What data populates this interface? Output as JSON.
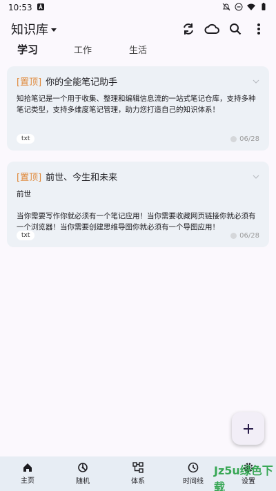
{
  "status_bar": {
    "time": "10:53"
  },
  "app_bar": {
    "library_title": "知识库",
    "actions": [
      "sync-icon",
      "cloud-icon",
      "search-icon",
      "more-icon"
    ]
  },
  "tabs": [
    {
      "label": "学习",
      "active": true
    },
    {
      "label": "工作",
      "active": false
    },
    {
      "label": "生活",
      "active": false
    }
  ],
  "notes": [
    {
      "pin_label": "[置顶]",
      "title": "你的全能笔记助手",
      "body": "知拾笔记是一个用于收集、整理和编辑信息流的一站式笔记仓库，支持多种笔记类型，支持多维度笔记管理，助力您打造自己的知识体系！",
      "tag": "txt",
      "date": "06/28"
    },
    {
      "pin_label": "[置顶]",
      "title": "前世、今生和未来",
      "body": "前世\n\n当你需要写作你就必须有一个笔记应用！当你需要收藏网页链接你就必须有一个浏览器！当你需要创建思维导图你就必须有一个导图应用！",
      "tag": "txt",
      "date": "06/28"
    }
  ],
  "bottom_nav": [
    {
      "label": "主页",
      "icon": "home-icon"
    },
    {
      "label": "随机",
      "icon": "random-icon"
    },
    {
      "label": "体系",
      "icon": "hierarchy-icon"
    },
    {
      "label": "时间线",
      "icon": "clock-icon"
    },
    {
      "label": "设置",
      "icon": "settings-icon"
    }
  ],
  "watermark": "Jz5u绿色下载",
  "colors": {
    "pin": "#e08a3c",
    "card_bg": "#edf1f6",
    "nav_bg": "#e7edf4"
  }
}
